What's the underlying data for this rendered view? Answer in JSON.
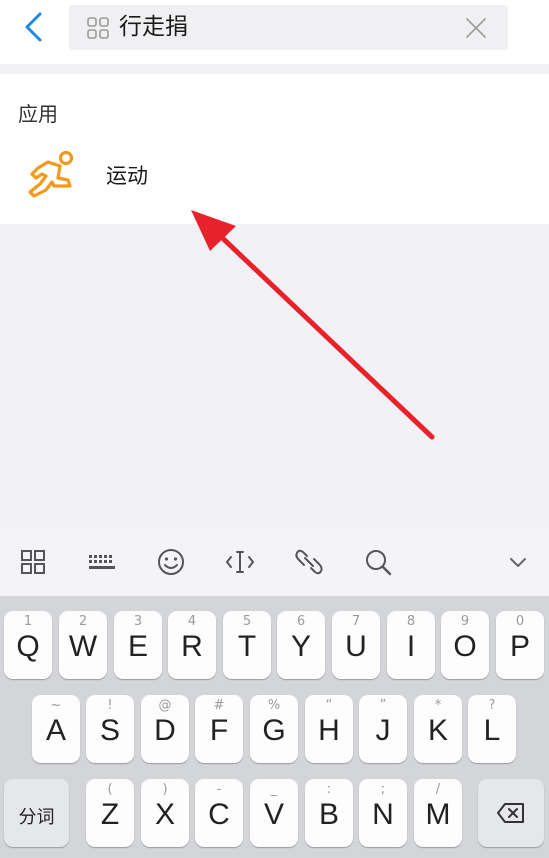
{
  "search": {
    "query": "行走捐",
    "back_icon": "chevron-left-icon",
    "prefix_icon": "grid-icon",
    "clear_icon": "close-icon"
  },
  "results": {
    "section_title": "应用",
    "apps": [
      {
        "label": "运动",
        "icon": "running-man-icon",
        "icon_color": "#f39a1d"
      }
    ]
  },
  "annotation": {
    "arrow_color": "#e8222a"
  },
  "keyboard_toolbar": {
    "icons": [
      "apps-grid-icon",
      "keyboard-icon",
      "emoji-icon",
      "cursor-icon",
      "link-icon",
      "search-icon",
      "chevron-down-icon"
    ]
  },
  "keyboard": {
    "row1": [
      {
        "key": "Q",
        "hint": "1"
      },
      {
        "key": "W",
        "hint": "2"
      },
      {
        "key": "E",
        "hint": "3"
      },
      {
        "key": "R",
        "hint": "4"
      },
      {
        "key": "T",
        "hint": "5"
      },
      {
        "key": "Y",
        "hint": "6"
      },
      {
        "key": "U",
        "hint": "7"
      },
      {
        "key": "I",
        "hint": "8"
      },
      {
        "key": "O",
        "hint": "9"
      },
      {
        "key": "P",
        "hint": "0"
      }
    ],
    "row2": [
      {
        "key": "A",
        "hint": "~"
      },
      {
        "key": "S",
        "hint": "!"
      },
      {
        "key": "D",
        "hint": "@"
      },
      {
        "key": "F",
        "hint": "#"
      },
      {
        "key": "G",
        "hint": "%"
      },
      {
        "key": "H",
        "hint": "“"
      },
      {
        "key": "J",
        "hint": "”"
      },
      {
        "key": "K",
        "hint": "*"
      },
      {
        "key": "L",
        "hint": "?"
      }
    ],
    "row3": [
      {
        "key": "Z",
        "hint": "("
      },
      {
        "key": "X",
        "hint": ")"
      },
      {
        "key": "C",
        "hint": "-"
      },
      {
        "key": "V",
        "hint": "_"
      },
      {
        "key": "B",
        "hint": ":"
      },
      {
        "key": "N",
        "hint": ";"
      },
      {
        "key": "M",
        "hint": "/"
      }
    ],
    "fenci_label": "分词",
    "backspace_icon": "backspace-icon"
  }
}
